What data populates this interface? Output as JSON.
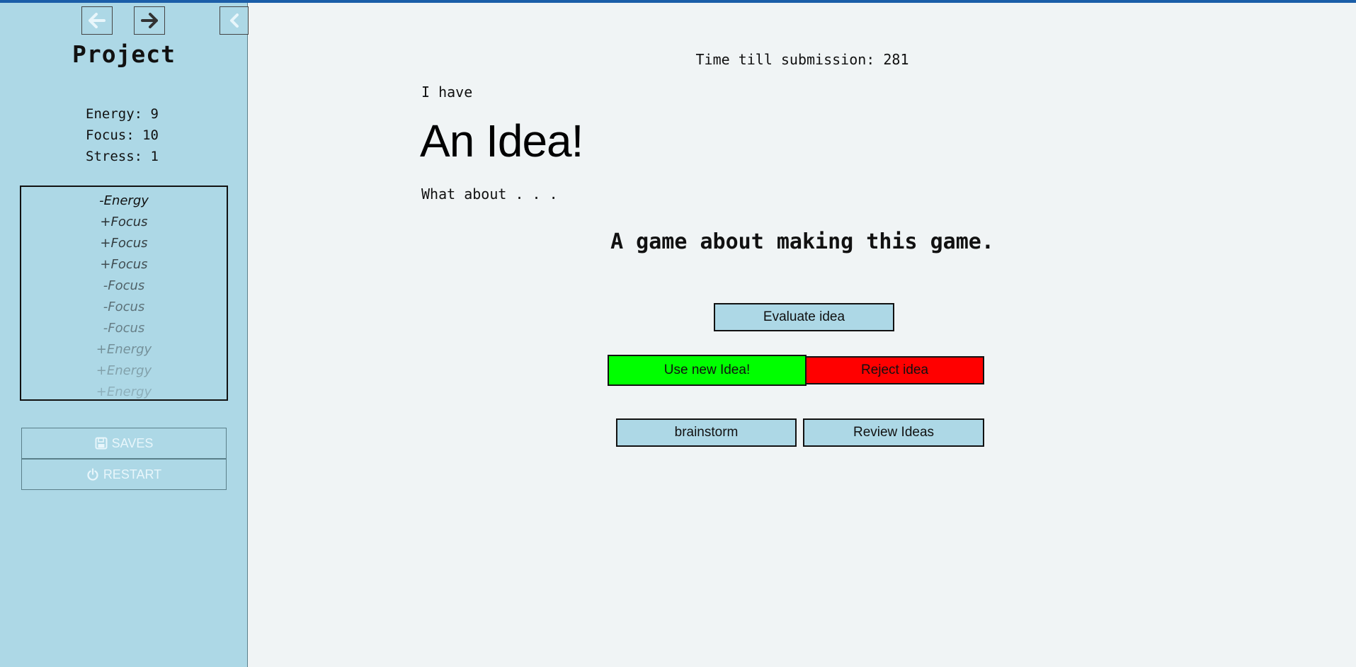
{
  "colors": {
    "sidebar_bg": "#add8e6",
    "main_bg": "#f0f4f5",
    "accent_bar": "#1b5ea8",
    "use_idea_bg": "#00ff00",
    "reject_idea_bg": "#ff0000",
    "neutral_btn_bg": "#add8e6"
  },
  "sidebar": {
    "nav": {
      "back_icon": "arrow-left-icon",
      "forward_icon": "arrow-right-icon",
      "collapse_icon": "chevron-left-icon"
    },
    "title": "Project",
    "stats": [
      {
        "label": "Energy",
        "value": "9",
        "text": "Energy: 9"
      },
      {
        "label": "Focus",
        "value": "10",
        "text": "Focus: 10"
      },
      {
        "label": "Stress",
        "value": "1",
        "text": "Stress: 1"
      }
    ],
    "history": [
      {
        "text": "-Energy",
        "opacity": 1.0
      },
      {
        "text": "+Focus",
        "opacity": 0.85
      },
      {
        "text": "+Focus",
        "opacity": 0.78
      },
      {
        "text": "+Focus",
        "opacity": 0.7
      },
      {
        "text": "-Focus",
        "opacity": 0.6
      },
      {
        "text": "-Focus",
        "opacity": 0.52
      },
      {
        "text": "-Focus",
        "opacity": 0.45
      },
      {
        "text": "+Energy",
        "opacity": 0.36
      },
      {
        "text": "+Energy",
        "opacity": 0.28
      },
      {
        "text": "+Energy",
        "opacity": 0.2
      }
    ],
    "menu": {
      "saves_label": "SAVES",
      "saves_icon": "floppy-disk-icon",
      "restart_label": "RESTART",
      "restart_icon": "power-icon"
    }
  },
  "main": {
    "timer": "Time till submission: 281",
    "intro": "I have",
    "headline": "An Idea!",
    "prompt": "What about . . .",
    "idea": "A game about making this game.",
    "buttons": {
      "evaluate": "Evaluate idea",
      "use_new": "Use new Idea!",
      "reject": "Reject idea",
      "brainstorm": "brainstorm",
      "review": "Review Ideas"
    }
  }
}
